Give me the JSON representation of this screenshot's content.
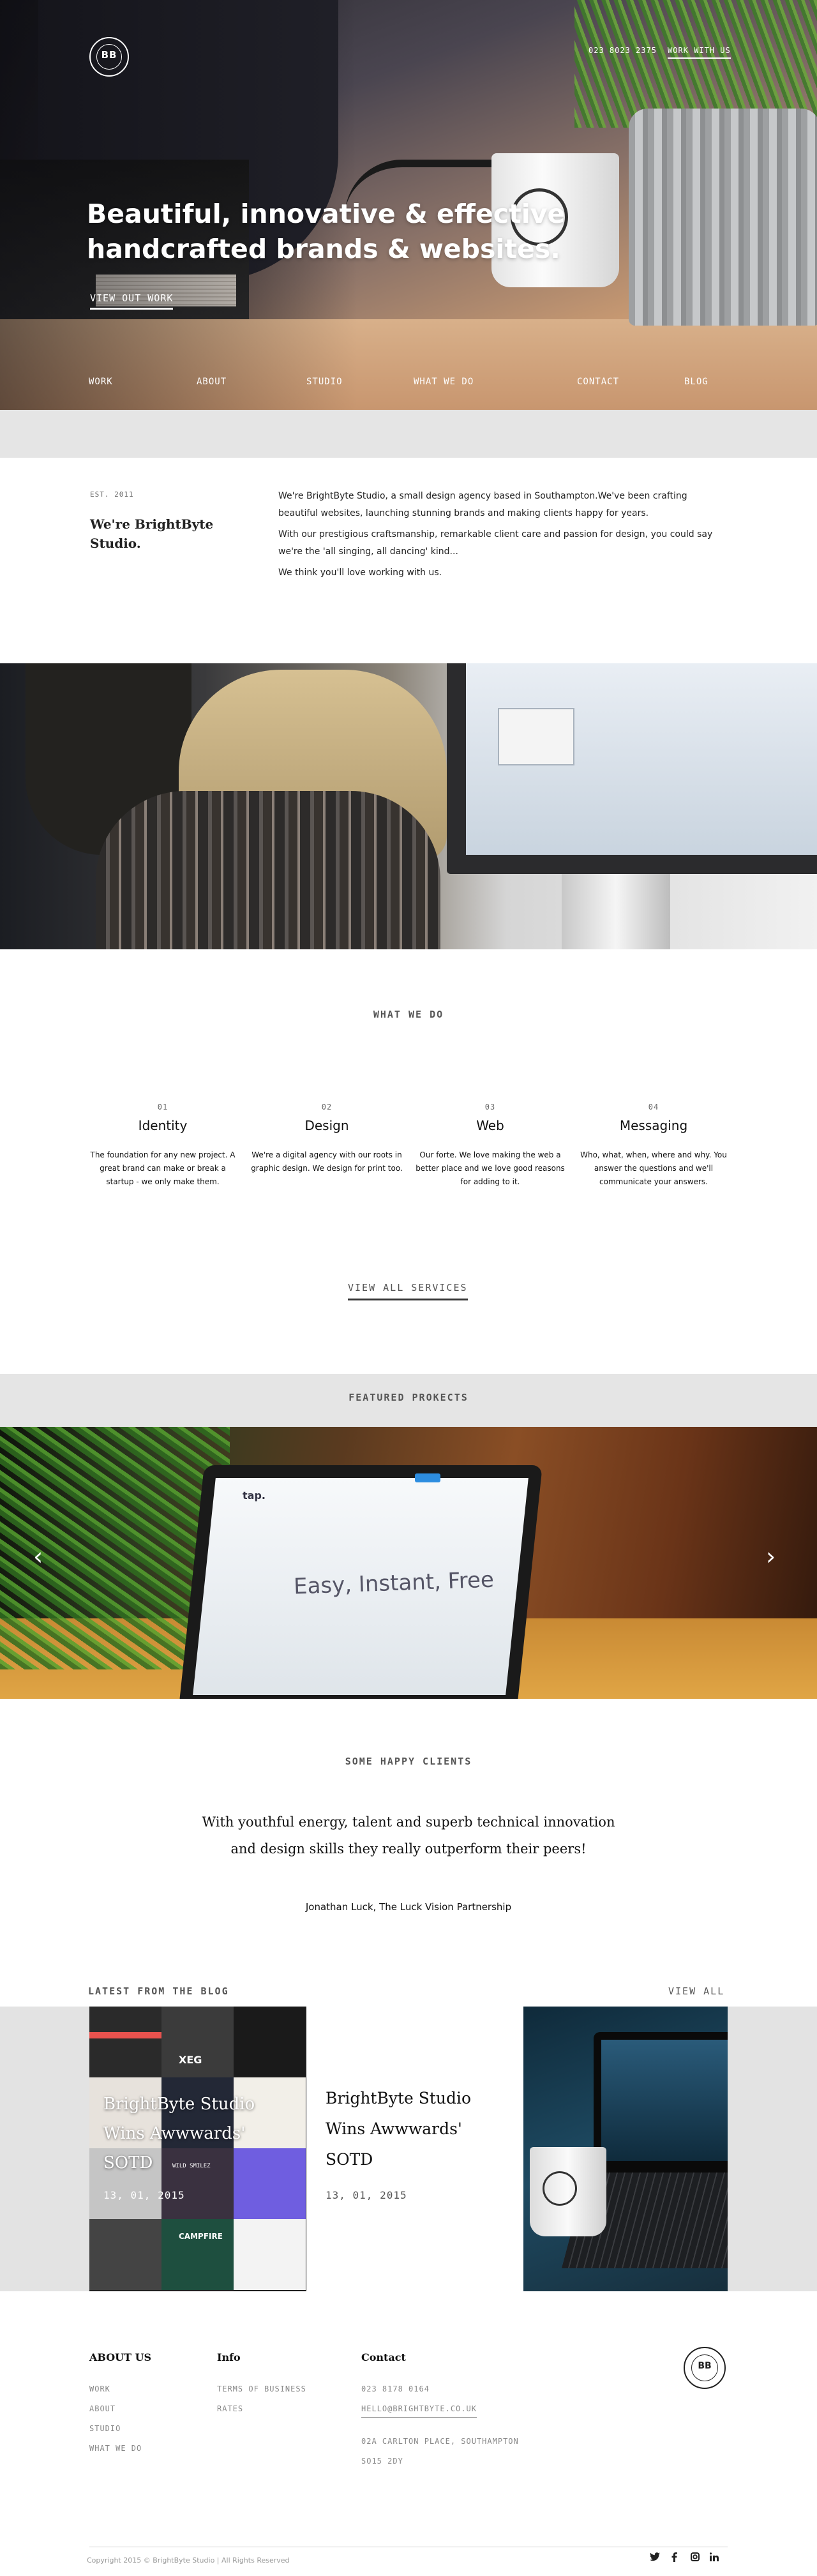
{
  "header": {
    "logo_text": "BB",
    "phone": "023 8023 2375",
    "work_with_us": "WORK WITH US"
  },
  "hero": {
    "title_line1": "Beautiful, innovative & effective",
    "title_line2": "handcrafted brands & websites.",
    "cta": "VIEW OUT WORK",
    "nav": [
      "WORK",
      "ABOUT",
      "STUDIO",
      "WHAT WE DO",
      "CONTACT",
      "BLOG"
    ]
  },
  "intro": {
    "est": "EST. 2011",
    "heading": "We're BrightByte Studio.",
    "paragraphs": [
      "We're BrightByte Studio, a small design agency based in Southampton.We've been crafting beautiful websites, launching stunning brands and making clients happy for years.",
      "With our prestigious craftsmanship, remarkable client care and passion for design, you could say we're the 'all singing, all dancing' kind...",
      "We think you'll love working with us."
    ]
  },
  "what_we_do": {
    "title": "WHAT WE DO",
    "services": [
      {
        "num": "01",
        "name": "Identity",
        "desc": "The foundation for any new project. A great brand can make or break a startup - we only make them."
      },
      {
        "num": "02",
        "name": "Design",
        "desc": "We're a digital agency with our roots in graphic design. We design for print too."
      },
      {
        "num": "03",
        "name": "Web",
        "desc": "Our forte. We love making the web a better place and we love good reasons for adding to it."
      },
      {
        "num": "04",
        "name": "Messaging",
        "desc": "Who, what, when, where and why. You answer the questions and we'll communicate your answers."
      }
    ],
    "view_all": "VIEW ALL SERVICES"
  },
  "featured": {
    "title": "FEATURED PROKECTS",
    "screen_logo": "tap.",
    "screen_headline": "Easy, Instant, Free",
    "prev_arrow": "‹",
    "next_arrow": "›"
  },
  "testimonial": {
    "title": "SOME HAPPY CLIENTS",
    "quote_line1": "With youthful energy, talent and superb technical innovation",
    "quote_line2": "and design skills they really outperform their peers!",
    "author": "Jonathan Luck, The Luck Vision Partnership"
  },
  "blog": {
    "title": "LATEST FROM THE BLOG",
    "view_all": "VIEW ALL",
    "card1": {
      "title": "BrightByte Studio Wins Awwwards' SOTD",
      "date": "13, 01, 2015"
    },
    "card2": {
      "title": "BrightByte Studio Wins Awwwards' SOTD",
      "date": "13, 01, 2015"
    },
    "tile_labels": [
      "XEG",
      "WILD SMILEZ",
      "CAMPFIRE"
    ]
  },
  "footer": {
    "about_heading": "ABOUT US",
    "about_links": [
      "WORK",
      "ABOUT",
      "STUDIO",
      "WHAT WE DO"
    ],
    "info_heading": "Info",
    "info_links": [
      "TERMS OF BUSINESS",
      "RATES"
    ],
    "contact_heading": "Contact",
    "phone": "023 8178 0164",
    "email": "HELLO@BRIGHTBYTE.CO.UK",
    "address_line1": "02A CARLTON PLACE, SOUTHAMPTON",
    "address_line2": "SO15 2DY",
    "logo_text": "BB",
    "copyright": "Copyright 2015 © BrightByte Studio | All Rights Reserved",
    "social": [
      "twitter-icon",
      "facebook-icon",
      "instagram-icon",
      "linkedin-icon"
    ]
  }
}
